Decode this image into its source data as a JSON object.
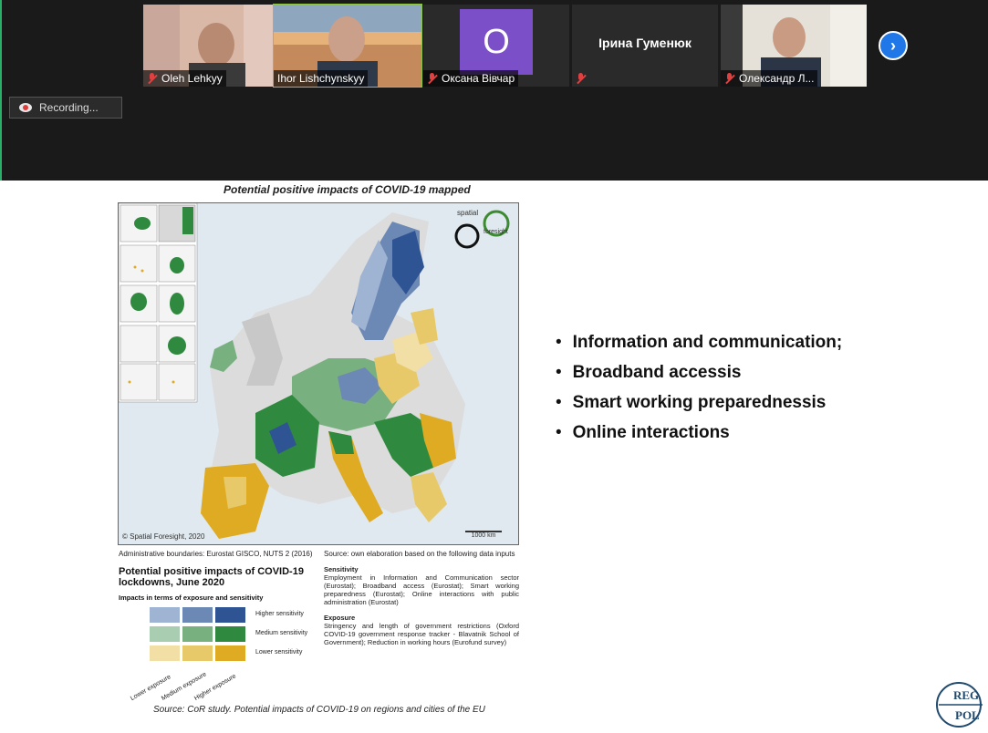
{
  "participants": [
    {
      "name": "Oleh Lehkyy",
      "muted": true,
      "type": "video"
    },
    {
      "name": "Ihor Lishchynskyy",
      "muted": false,
      "type": "video",
      "active": true
    },
    {
      "name": "Оксана Вівчар",
      "muted": true,
      "type": "avatar",
      "initial": "O",
      "avatar_color": "#7b4fc8"
    },
    {
      "name": "Ірина Гуменюк",
      "muted": true,
      "type": "name-only"
    },
    {
      "name": "Олександр Л...",
      "muted": true,
      "type": "video"
    }
  ],
  "recording": {
    "label": "Recording..."
  },
  "next_icon": "chevron-right-icon",
  "slide": {
    "figure_title": "Potential positive impacts of COVID-19 mapped",
    "map": {
      "copyright": "© Spatial Foresight, 2020",
      "scale": "1000 km",
      "brand_top": "spatial",
      "brand_bottom": "foresight"
    },
    "admin_boundaries": "Administrative boundaries: Eurostat GISCO, NUTS 2 (2016)",
    "source_inputs": "Source: own elaboration based on the following data inputs",
    "legend": {
      "title": "Potential positive impacts of COVID-19 lockdowns, June 2020",
      "subtitle": "Impacts in terms of exposure and sensitivity",
      "rows": [
        "Higher sensitivity",
        "Medium sensitivity",
        "Lower sensitivity"
      ],
      "cols": [
        "Lower exposure",
        "Medium exposure",
        "Higher exposure"
      ],
      "colors": [
        [
          "#9fb3d2",
          "#6c88b5",
          "#2f5494"
        ],
        [
          "#a9cdb0",
          "#78b07f",
          "#2f8a3f"
        ],
        [
          "#f1dfa5",
          "#e8c96a",
          "#dfab22"
        ]
      ]
    },
    "sensitivity": {
      "label": "Sensitivity",
      "text": "Employment in Information and Communication sector (Eurostat); Broadband access (Eurostat); Smart working preparedness (Eurostat); Online interactions with public administration (Eurostat)"
    },
    "exposure": {
      "label": "Exposure",
      "text": "Stringency and length of government restrictions (Oxford COVID-19 government response tracker - Blavatnik School of Government); Reduction in working hours (Eurofund survey)"
    },
    "source_bottom": "Source: CoR study. Potential impacts of COVID-19 on regions and cities of the EU",
    "bullets": [
      "Information and communication;",
      "Broadband accessis",
      "Smart working preparednessis",
      "Online interactions"
    ],
    "logo": {
      "line1": "REG",
      "line2": "POL"
    }
  }
}
